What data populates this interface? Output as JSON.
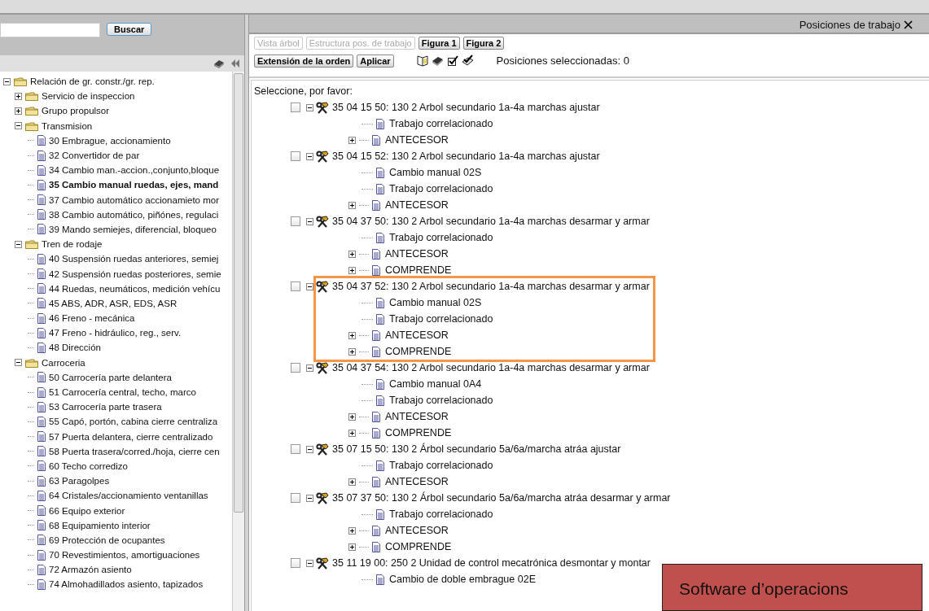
{
  "search": {
    "button": "Buscar"
  },
  "tree": {
    "label": "Relación de gr. constr./gr. rep.",
    "kind": "folder",
    "expanded": true,
    "children": [
      {
        "label": "Servicio de inspeccion",
        "kind": "folder",
        "expanded": false
      },
      {
        "label": "Grupo propulsor",
        "kind": "folder",
        "expanded": false
      },
      {
        "label": "Transmision",
        "kind": "folder",
        "expanded": true,
        "children": [
          {
            "label": "30 Embrague, accionamiento",
            "kind": "document",
            "selected": false
          },
          {
            "label": "32 Convertidor de par",
            "kind": "document",
            "selected": false
          },
          {
            "label": "34 Cambio man.-accion.,conjunto,bloque",
            "kind": "document",
            "selected": false
          },
          {
            "label": "35 Cambio manual ruedas, ejes, mand",
            "kind": "document",
            "selected": true
          },
          {
            "label": "37 Cambio automático accionamieto mor",
            "kind": "document",
            "selected": false
          },
          {
            "label": "38 Cambio automático, piñónes, regulaci",
            "kind": "document",
            "selected": false
          },
          {
            "label": "39 Mando semiejes, diferencial, bloqueo",
            "kind": "document",
            "selected": false
          }
        ]
      },
      {
        "label": "Tren de rodaje",
        "kind": "folder",
        "expanded": true,
        "children": [
          {
            "label": "40 Suspensión ruedas anteriores, semiej",
            "kind": "document",
            "selected": false
          },
          {
            "label": "42 Suspensión ruedas posteriores, semie",
            "kind": "document",
            "selected": false
          },
          {
            "label": "44 Ruedas, neumáticos, medición vehícu",
            "kind": "document",
            "selected": false
          },
          {
            "label": "45 ABS, ADR, ASR, EDS, ASR",
            "kind": "document",
            "selected": false
          },
          {
            "label": "46 Freno - mecánica",
            "kind": "document",
            "selected": false
          },
          {
            "label": "47 Freno - hidráulico, reg., serv.",
            "kind": "document",
            "selected": false
          },
          {
            "label": "48 Dirección",
            "kind": "document",
            "selected": false
          }
        ]
      },
      {
        "label": "Carroceria",
        "kind": "folder",
        "expanded": true,
        "children": [
          {
            "label": "50 Carrocería parte delantera",
            "kind": "document",
            "selected": false
          },
          {
            "label": "51 Carrocería central, techo, marco",
            "kind": "document",
            "selected": false
          },
          {
            "label": "53 Carrocería parte trasera",
            "kind": "document",
            "selected": false
          },
          {
            "label": "55 Capó, portón, cabina cierre centraliza",
            "kind": "document",
            "selected": false
          },
          {
            "label": "57 Puerta delantera, cierre centralizado",
            "kind": "document",
            "selected": false
          },
          {
            "label": "58 Puerta trasera/corred./hoja, cierre cen",
            "kind": "document",
            "selected": false
          },
          {
            "label": "60 Techo corredizo",
            "kind": "document",
            "selected": false
          },
          {
            "label": "63 Paragolpes",
            "kind": "document",
            "selected": false
          },
          {
            "label": "64 Cristales/accionamiento ventanillas",
            "kind": "document",
            "selected": false
          },
          {
            "label": "66 Equipo exterior",
            "kind": "document",
            "selected": false
          },
          {
            "label": "68 Equipamiento interior",
            "kind": "document",
            "selected": false
          },
          {
            "label": "69 Protección de ocupantes",
            "kind": "document",
            "selected": false
          },
          {
            "label": "70 Revestimientos, amortiguaciones",
            "kind": "document",
            "selected": false
          },
          {
            "label": "72 Armazón asiento",
            "kind": "document",
            "selected": false
          },
          {
            "label": "74 Almohadillados asiento, tapizados",
            "kind": "document",
            "selected": false
          }
        ]
      }
    ]
  },
  "panel": {
    "title": "Posiciones de trabajo",
    "toolbar_row_1": [
      {
        "label": "Vista árbol",
        "disabled": true
      },
      {
        "label": "Estructura pos. de trabajo",
        "disabled": true
      },
      {
        "label": "Figura 1",
        "disabled": false
      },
      {
        "label": "Figura 2",
        "disabled": false
      }
    ],
    "toolbar_row_2": [
      {
        "label": "Extensión de la orden",
        "disabled": false
      },
      {
        "label": "Aplicar",
        "disabled": false
      }
    ],
    "status": "Posiciones seleccionadas: 0",
    "prompt": "Seleccione, por favor:",
    "positions": [
      {
        "label": "35 04 15 50: 130 2 Arbol secundario 1a-4a marchas ajustar",
        "checked": false,
        "highlighted": false,
        "children": [
          {
            "label": "Trabajo correlacionado",
            "expandable": false
          },
          {
            "label": "ANTECESOR",
            "expandable": true
          }
        ]
      },
      {
        "label": "35 04 15 52: 130 2 Arbol secundario 1a-4a marchas ajustar",
        "checked": false,
        "highlighted": false,
        "children": [
          {
            "label": "Cambio manual 02S",
            "expandable": false
          },
          {
            "label": "Trabajo correlacionado",
            "expandable": false
          },
          {
            "label": "ANTECESOR",
            "expandable": true
          }
        ]
      },
      {
        "label": "35 04 37 50: 130 2 Arbol secundario 1a-4a marchas desarmar y armar",
        "checked": false,
        "highlighted": false,
        "children": [
          {
            "label": "Trabajo correlacionado",
            "expandable": false
          },
          {
            "label": "ANTECESOR",
            "expandable": true
          },
          {
            "label": "COMPRENDE",
            "expandable": true
          }
        ]
      },
      {
        "label": "35 04 37 52: 130 2 Arbol secundario 1a-4a marchas desarmar y armar",
        "checked": false,
        "highlighted": true,
        "children": [
          {
            "label": "Cambio manual 02S",
            "expandable": false
          },
          {
            "label": "Trabajo correlacionado",
            "expandable": false
          },
          {
            "label": "ANTECESOR",
            "expandable": true
          },
          {
            "label": "COMPRENDE",
            "expandable": true
          }
        ]
      },
      {
        "label": "35 04 37 54: 130 2 Arbol secundario 1a-4a marchas desarmar y armar",
        "checked": false,
        "highlighted": false,
        "children": [
          {
            "label": "Cambio manual 0A4",
            "expandable": false
          },
          {
            "label": "Trabajo correlacionado",
            "expandable": false
          },
          {
            "label": "ANTECESOR",
            "expandable": true
          },
          {
            "label": "COMPRENDE",
            "expandable": true
          }
        ]
      },
      {
        "label": "35 07 15 50: 130 2 Árbol secundario 5a/6a/marcha atráa ajustar",
        "checked": false,
        "highlighted": false,
        "children": [
          {
            "label": "Trabajo correlacionado",
            "expandable": false
          },
          {
            "label": "ANTECESOR",
            "expandable": true
          }
        ]
      },
      {
        "label": "35 07 37 50: 130 2 Árbol secundario 5a/6a/marcha atráa desarmar y armar",
        "checked": false,
        "highlighted": false,
        "children": [
          {
            "label": "Trabajo correlacionado",
            "expandable": false
          },
          {
            "label": "ANTECESOR",
            "expandable": true
          },
          {
            "label": "COMPRENDE",
            "expandable": true
          }
        ]
      },
      {
        "label": "35 11 19 00: 250 2 Unidad de control mecatrónica desmontar y montar",
        "checked": false,
        "highlighted": false,
        "children": [
          {
            "label": "Cambio de doble embrague 02E",
            "expandable": false
          }
        ]
      }
    ]
  },
  "annotation": {
    "text": "Software d’operacions"
  }
}
